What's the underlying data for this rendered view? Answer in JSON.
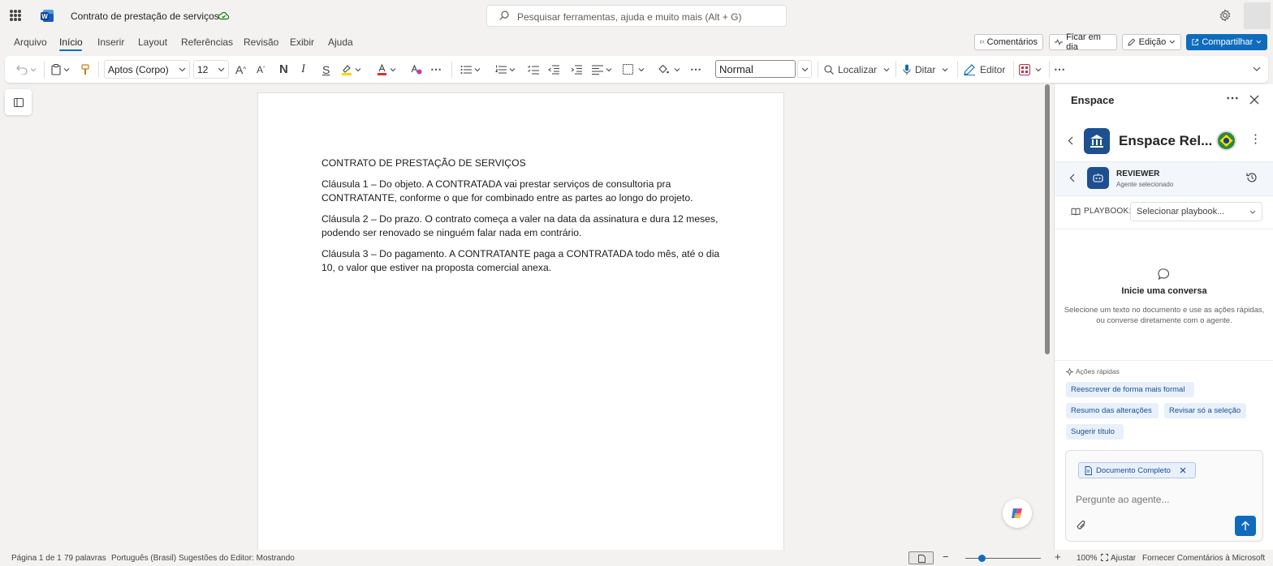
{
  "titlebar": {
    "doc_title": "Contrato de prestação de serviços",
    "search_placeholder": "Pesquisar ferramentas, ajuda e muito mais (Alt + G)"
  },
  "menu": {
    "tabs": [
      "Arquivo",
      "Início",
      "Inserir",
      "Layout",
      "Referências",
      "Revisão",
      "Exibir",
      "Ajuda"
    ],
    "active_tab": "Início",
    "comments_label": "Comentários",
    "catchup_label": "Ficar em dia",
    "editing_label": "Edição",
    "share_label": "Compartilhar"
  },
  "ribbon": {
    "font_name": "Aptos (Corpo)",
    "font_size": "12",
    "bold_glyph": "N",
    "italic_glyph": "I",
    "strike_glyph": "S",
    "style_value": "Normal",
    "find_label": "Localizar",
    "dictate_label": "Ditar",
    "editor_label": "Editor"
  },
  "document": {
    "paragraphs": [
      "CONTRATO DE PRESTAÇÃO DE SERVIÇOS",
      "Cláusula 1 – Do objeto. A CONTRATADA vai prestar serviços de consultoria pra CONTRATANTE, conforme o que for combinado entre as partes ao longo do projeto.",
      "Cláusula 2 – Do prazo. O contrato começa a valer na data da assinatura e dura 12 meses, podendo ser renovado se ninguém falar nada em contrário.",
      "Cláusula 3 – Do pagamento. A CONTRATANTE paga a CONTRATADA todo mês, até o dia 10, o valor que estiver na proposta comercial anexa."
    ]
  },
  "panel": {
    "title": "Enspace",
    "brand_name": "Enspace Rel...",
    "agent_name": "REVIEWER",
    "agent_subtitle": "Agente selecionado",
    "playbook_label": "PLAYBOOK:",
    "playbook_select": "Selecionar playbook...",
    "empty_title": "Inicie uma conversa",
    "empty_desc": "Selecione um texto no documento e use as ações rápidas, ou converse diretamente com o agente.",
    "quick_actions_label": "Ações rápidas",
    "quick_actions": [
      "Reescrever de forma mais formal",
      "Resumo das alterações",
      "Revisar só a seleção",
      "Sugerir título"
    ],
    "context_chip": "Documento Completo",
    "input_placeholder": "Pergunte ao agente..."
  },
  "status": {
    "page": "Página 1 de 1",
    "words": "79 palavras",
    "language": "Português (Brasil)",
    "editor_suggestions": "Sugestões do Editor: Mostrando",
    "zoom": "100%",
    "fit_label": "Ajustar",
    "feedback": "Fornecer Comentários à Microsoft"
  },
  "colors": {
    "accent": "#0f6cbd",
    "brand": "#1d4f91",
    "chip_bg": "#e8f0fb"
  }
}
